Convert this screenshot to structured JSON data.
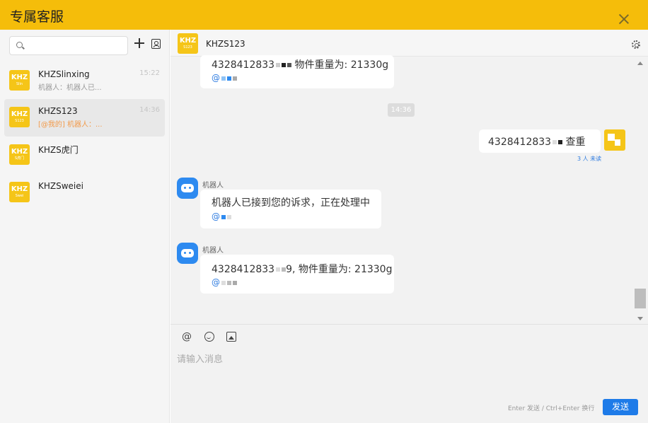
{
  "window": {
    "title": "专属客服",
    "close_icon": "close-icon"
  },
  "sidebar": {
    "search": {
      "placeholder": "",
      "value": "",
      "icon": "search-icon"
    },
    "add_icon": "plus-icon",
    "contacts_icon": "contacts-icon",
    "conversations": [
      {
        "name": "KHZSlinxing",
        "time": "15:22",
        "preview": "机器人：机器人已...",
        "avatar": {
          "line1": "KHZ",
          "line2": "Slin"
        },
        "active": false,
        "mention": false
      },
      {
        "name": "KHZS123",
        "time": "14:36",
        "preview": "[@我的] 机器人：...",
        "avatar": {
          "line1": "KHZ",
          "line2": "S123"
        },
        "active": true,
        "mention": true
      },
      {
        "name": "KHZS虎门",
        "time": "",
        "preview": "",
        "avatar": {
          "line1": "KHZ",
          "line2": "S虎门"
        },
        "active": false,
        "mention": false
      },
      {
        "name": "KHZSweiei",
        "time": "",
        "preview": "",
        "avatar": {
          "line1": "KHZ",
          "line2": "Swei"
        },
        "active": false,
        "mention": false
      }
    ]
  },
  "chat": {
    "header": {
      "name": "KHZS123",
      "avatar": {
        "line1": "KHZ",
        "line2": "S123"
      },
      "settings_icon": "gear-icon"
    },
    "messages": [
      {
        "type": "incoming",
        "text": "4328412833",
        "text_tail": "物件重量为: 21330g",
        "sub": "@"
      },
      {
        "type": "time",
        "text": "14:36"
      },
      {
        "type": "outgoing",
        "text": "4328412833",
        "text_tail": "查重",
        "unread": "3 人 未读"
      },
      {
        "type": "incoming",
        "sender": "机器人",
        "text": "机器人已接到您的诉求，正在处理中",
        "sub": "@"
      },
      {
        "type": "incoming",
        "sender": "机器人",
        "text": "4328412833",
        "text_tail": "9, 物件重量为: 21330g",
        "sub": "@"
      }
    ]
  },
  "composer": {
    "toolbar": {
      "mention_icon": "at-icon",
      "emoji_icon": "emoji-icon",
      "image_icon": "image-icon",
      "mention_glyph": "@"
    },
    "placeholder": "请输入消息",
    "hint": "Enter 发送 / Ctrl+Enter 换行",
    "send_label": "发送"
  },
  "colors": {
    "title_bar": "#f5bd0a",
    "avatar": "#f5c518",
    "accent": "#1e7be8",
    "mention": "#f29a4a",
    "bot": "#2d8af0"
  }
}
